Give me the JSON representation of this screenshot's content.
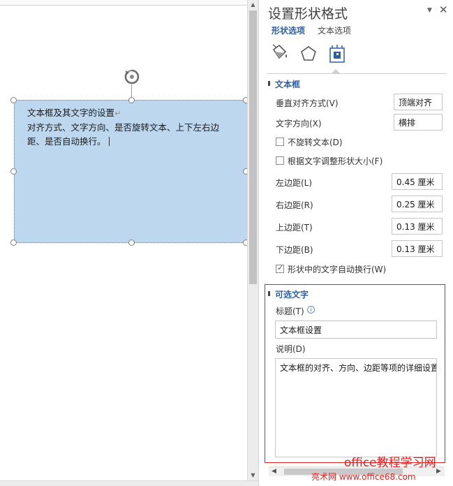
{
  "document": {
    "textbox": {
      "line1": "文本框及其文字的设置",
      "line2": "对齐方式、文字方向、是否旋转文本、上下左右边",
      "line3": "距、是否自动换行。",
      "paragraph_mark": "↵",
      "fill_color": "#bdd7ee"
    },
    "scrollbar": {
      "up_arrow": "▲",
      "down_arrow": "▼"
    }
  },
  "pane": {
    "title": "设置形状格式",
    "dropdown_icon": "▼",
    "close_icon": "✕",
    "tabs": [
      {
        "label": "形状选项",
        "active": true
      },
      {
        "label": "文本选项",
        "active": false
      }
    ],
    "category_icons": [
      "fill-line-icon",
      "effects-pentagon-icon",
      "layout-properties-icon"
    ],
    "accent_color": "#2e5e9e",
    "textbox_section": {
      "title": "文本框",
      "vertical_align_label": "垂直对齐方式(V)",
      "vertical_align_value": "顶端对齐",
      "text_direction_label": "文字方向(X)",
      "text_direction_value": "横排",
      "no_rotate_label": "不旋转文本(D)",
      "no_rotate_checked": false,
      "resize_label": "根据文字调整形状大小(F)",
      "resize_checked": false,
      "left_margin_label": "左边距(L)",
      "left_margin_value": "0.45 厘米",
      "right_margin_label": "右边距(R)",
      "right_margin_value": "0.25 厘米",
      "top_margin_label": "上边距(T)",
      "top_margin_value": "0.13 厘米",
      "bottom_margin_label": "下边距(B)",
      "bottom_margin_value": "0.13 厘米",
      "wrap_label": "形状中的文字自动换行(W)",
      "wrap_checked": true,
      "check_glyph": "✓"
    },
    "alt_text_section": {
      "title": "可选文字",
      "title_label": "标题(T)",
      "info_glyph": "i",
      "title_value": "文本框设置",
      "description_label": "说明(D)",
      "description_value": "文本框的对齐、方向、边距等项的详细设置",
      "highlight_color": "#e02020"
    },
    "scroll": {
      "left_arrow": "◀",
      "right_arrow": "▶"
    }
  },
  "watermark": {
    "line1": "office教程学习网",
    "line2": "亮术网 www.office68.com"
  }
}
